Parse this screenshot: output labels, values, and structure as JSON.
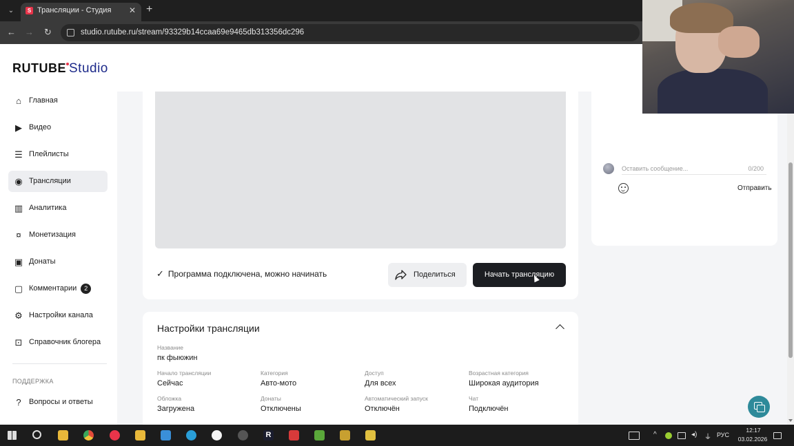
{
  "browser": {
    "tab_title": "Трансляции - Студия RUTUBE",
    "tab_favicon": "S",
    "url": "studio.rutube.ru/stream/93329b14ccaa69e9465db313356dc296"
  },
  "logo": {
    "brand": "RUTUBE",
    "product": "Studio"
  },
  "sidebar": {
    "items": [
      {
        "label": "Главная",
        "icon": "home-icon"
      },
      {
        "label": "Видео",
        "icon": "video-icon"
      },
      {
        "label": "Плейлисты",
        "icon": "playlist-icon"
      },
      {
        "label": "Трансляции",
        "icon": "broadcast-icon",
        "active": true
      },
      {
        "label": "Аналитика",
        "icon": "analytics-icon"
      },
      {
        "label": "Монетизация",
        "icon": "monetization-icon"
      },
      {
        "label": "Донаты",
        "icon": "donate-icon"
      },
      {
        "label": "Комментарии",
        "icon": "comments-icon",
        "badge": "2"
      },
      {
        "label": "Настройки канала",
        "icon": "gear-icon"
      },
      {
        "label": "Справочник блогера",
        "icon": "handbook-icon"
      }
    ],
    "section_title": "ПОДДЕРЖКА",
    "support_items": [
      {
        "label": "Вопросы и ответы",
        "icon": "help-icon"
      }
    ]
  },
  "player": {
    "status": "Программа подключена, можно начинать",
    "share_label": "Поделиться",
    "start_label": "Начать трансляцию"
  },
  "settings": {
    "title": "Настройки трансляции",
    "name_label": "Название",
    "name_value": "пк фыюжин",
    "fields": [
      {
        "label": "Начало трансляции",
        "value": "Сейчас"
      },
      {
        "label": "Категория",
        "value": "Авто-мото"
      },
      {
        "label": "Доступ",
        "value": "Для всех"
      },
      {
        "label": "Возрастная категория",
        "value": "Широкая аудитория"
      },
      {
        "label": "Обложка",
        "value": "Загружена"
      },
      {
        "label": "Донаты",
        "value": "Отключены"
      },
      {
        "label": "Автоматический запуск",
        "value": "Отключён"
      },
      {
        "label": "Чат",
        "value": "Подключён"
      }
    ]
  },
  "chat": {
    "placeholder": "Оставить сообщение...",
    "counter": "0/200",
    "send_label": "Отправить"
  },
  "taskbar": {
    "lang": "РУС",
    "time": "12:17",
    "date": "03.02.2026"
  },
  "colors": {
    "accent_dark": "#1c1e22",
    "brand_red": "#e8344a",
    "support_teal": "#2e8a9a"
  }
}
